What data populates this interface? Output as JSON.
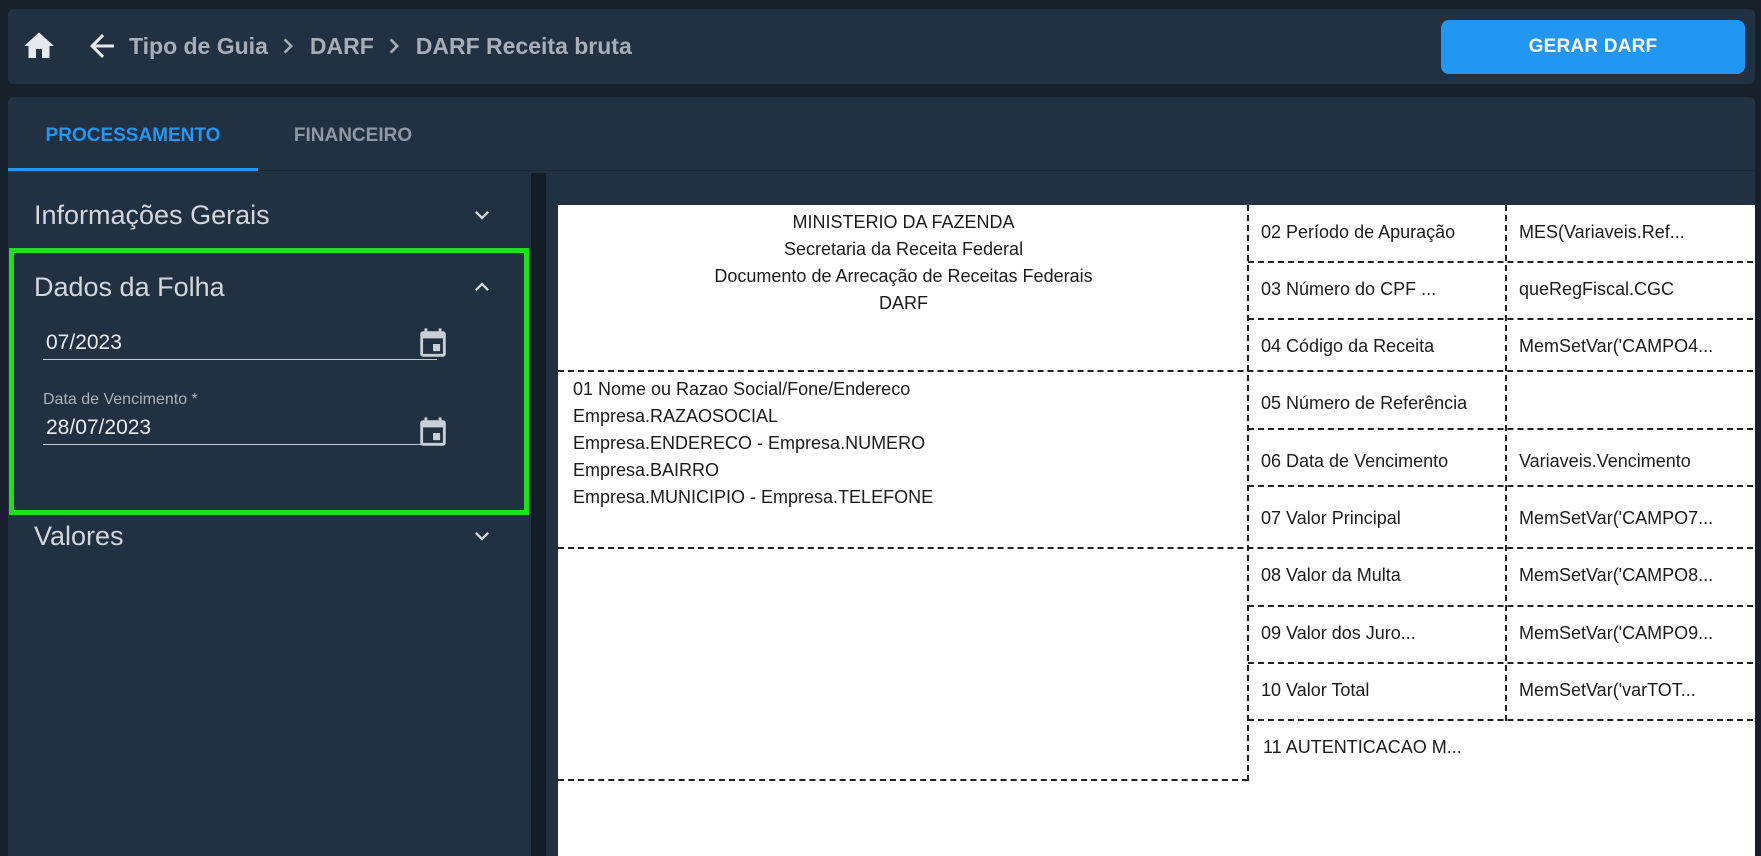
{
  "header": {
    "home_icon": "home-icon",
    "back_icon": "arrow-left-icon",
    "breadcrumb": [
      "Tipo de Guia",
      "DARF",
      "DARF Receita bruta"
    ],
    "action_button": "GERAR DARF",
    "accent_color": "#2196f3"
  },
  "tabs": [
    {
      "label": "PROCESSAMENTO",
      "active": true
    },
    {
      "label": "FINANCEIRO",
      "active": false
    }
  ],
  "sidebar": {
    "sections": [
      {
        "title": "Informações Gerais",
        "expanded": false
      },
      {
        "title": "Dados da Folha",
        "expanded": true
      },
      {
        "title": "Valores",
        "expanded": false
      }
    ],
    "fields": [
      {
        "label": "",
        "value": "07/2023",
        "icon": "calendar-icon"
      },
      {
        "label": "Data de Vencimento *",
        "value": "28/07/2023",
        "icon": "calendar-icon"
      }
    ],
    "highlight_color": "#1de11f"
  },
  "preview": {
    "ministry_lines": [
      "MINISTERIO DA FAZENDA",
      "Secretaria da Receita Federal",
      "Documento de Arrecação de Receitas Federais",
      "DARF"
    ],
    "info_lines": [
      "01 Nome ou Razao Social/Fone/Endereco",
      "Empresa.RAZAOSOCIAL",
      "Empresa.ENDERECO - Empresa.NUMERO",
      "Empresa.BAIRRO",
      "Empresa.MUNICIPIO - Empresa.TELEFONE"
    ],
    "rows": [
      {
        "label": "02 Período de Apuração",
        "value": "MES(Variaveis.Ref..."
      },
      {
        "label": "03 Número do CPF ...",
        "value": "queRegFiscal.CGC"
      },
      {
        "label": "04 Código da Receita",
        "value": "MemSetVar('CAMPO4..."
      },
      {
        "label": "05 Número de Referência",
        "value": ""
      },
      {
        "label": "06 Data de Vencimento",
        "value": "Variaveis.Vencimento"
      },
      {
        "label": "07 Valor Principal",
        "value": "MemSetVar('CAMPO7..."
      },
      {
        "label": "08 Valor da Multa",
        "value": "MemSetVar('CAMPO8..."
      },
      {
        "label": "09 Valor dos Juro...",
        "value": "MemSetVar('CAMPO9..."
      },
      {
        "label": "10 Valor Total",
        "value": "MemSetVar('varTOT..."
      }
    ],
    "footer_label": "11 AUTENTICACAO M..."
  }
}
